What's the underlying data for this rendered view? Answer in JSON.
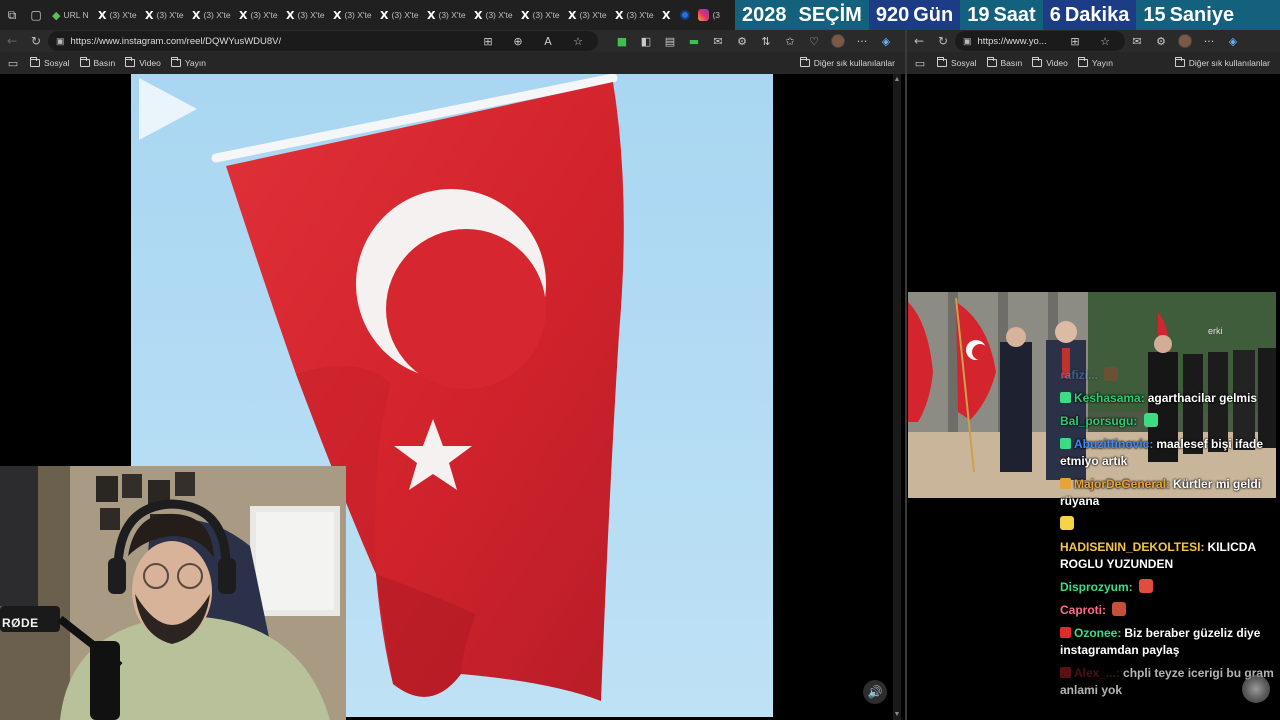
{
  "tabstrip": {
    "tabs": [
      {
        "fav": "",
        "label": "URL N"
      },
      {
        "fav": "X",
        "label": "(3) X'te"
      },
      {
        "fav": "X",
        "label": "(3) X'te"
      },
      {
        "fav": "X",
        "label": "(3) X'te"
      },
      {
        "fav": "X",
        "label": "(3) X'te"
      },
      {
        "fav": "X",
        "label": "(3) X'te"
      },
      {
        "fav": "X",
        "label": "(3) X'te"
      },
      {
        "fav": "X",
        "label": "(3) X'te"
      },
      {
        "fav": "X",
        "label": "(3) X'te"
      },
      {
        "fav": "X",
        "label": "(3) X'te"
      },
      {
        "fav": "X",
        "label": "(3) X'te"
      },
      {
        "fav": "X",
        "label": "(3) X'te"
      },
      {
        "fav": "X",
        "label": "(3) X'te"
      },
      {
        "fav": "X",
        "label": ""
      }
    ],
    "last_tab_label": "(3"
  },
  "countdown": {
    "year": "2028",
    "election": "SEÇİM",
    "days_value": "920",
    "days_unit": "Gün",
    "hours_value": "19",
    "hours_unit": "Saat",
    "minutes_value": "6",
    "minutes_unit": "Dakika",
    "seconds_value": "15",
    "seconds_unit": "Saniye",
    "colors": {
      "segment_a": "#14617e",
      "segment_b": "#1d3c86"
    }
  },
  "left_browser": {
    "url": "https://www.instagram.com/reel/DQWYusWDU8V/",
    "bookmarks": [
      "Sosyal",
      "Basın",
      "Video",
      "Yayın"
    ],
    "other_bookmarks": "Diğer sık kullanılanlar"
  },
  "right_browser": {
    "url": "https://www.yo...",
    "bookmarks": [
      "Sosyal",
      "Basın",
      "Video",
      "Yayın"
    ],
    "other_bookmarks": "Diğer sık kullanılanlar"
  },
  "reel": {
    "volume_icon": "speaker-icon",
    "play_icon": "play-icon",
    "flag_color": "#d9232f"
  },
  "webcam": {
    "mic_brand": "RØDE"
  },
  "news_video": {
    "overlay_text": "erki"
  },
  "chat": {
    "messages": [
      {
        "user": "rafizi...",
        "text": "",
        "color": "#6fa8ff",
        "badge": "",
        "faded": true
      },
      {
        "user": "Keshasama:",
        "text": "agarthacilar gelmis",
        "color": "#2ecc71",
        "badge": "#3ddc84"
      },
      {
        "user": "Bal_porsugu:",
        "text": "",
        "color": "#2ecc71",
        "badge": "",
        "emote": "#3ddc84"
      },
      {
        "user": "Abuzittinovic:",
        "text": "maalesef bişi ifade etmiyo artık",
        "color": "#3b8cff",
        "badge": "#3ddc84"
      },
      {
        "user": "MajorDeGeneral:",
        "text": "Kürtler mi geldi rüyana",
        "color": "#e8a23a",
        "badge": "#e8a23a"
      },
      {
        "user": "",
        "text": "",
        "color": "#fff",
        "badge": "#f5d547"
      },
      {
        "user": "HADISENIN_DEKOLTESI:",
        "text": "KILICDA ROGLU YUZUNDEN",
        "color": "#f5c542",
        "badge": ""
      },
      {
        "user": "Disprozyum:",
        "text": "",
        "color": "#3ddc84",
        "badge": "",
        "emote": "#e04d3c"
      },
      {
        "user": "Caproti:",
        "text": "",
        "color": "#ff6b8b",
        "badge": "",
        "emote": "#c8503a"
      },
      {
        "user": "Ozonee:",
        "text": "Biz beraber güzeliz diye instagramdan paylaş",
        "color": "#3ddc84",
        "badge": "#e02b2b"
      },
      {
        "user": "Alex_...:",
        "text": "chpli teyze icerigi bu gram anlami yok",
        "color": "#e02b2b",
        "badge": "#e02b2b",
        "faded": true
      }
    ]
  }
}
